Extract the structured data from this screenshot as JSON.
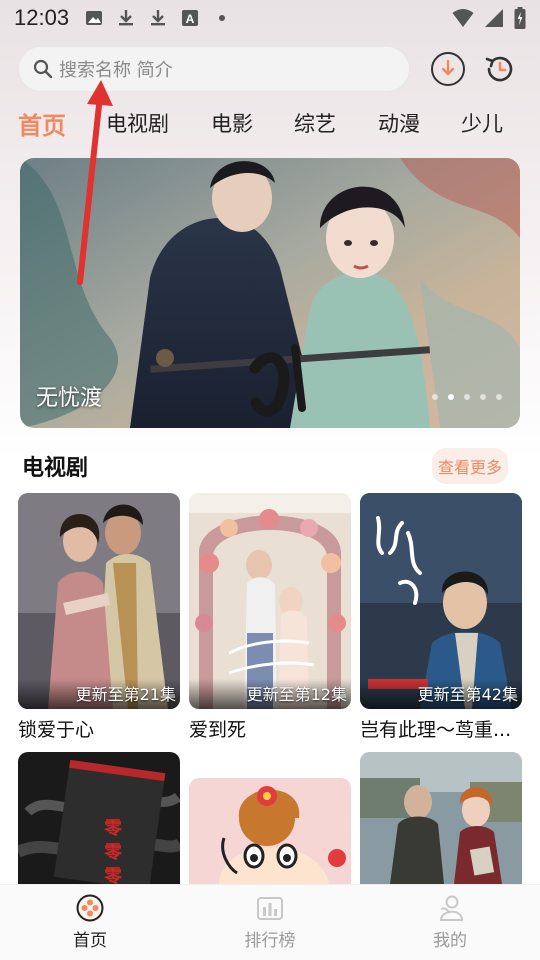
{
  "status_bar": {
    "time": "12:03",
    "left_icons": [
      "image-icon",
      "download-icon",
      "download-icon",
      "a-icon",
      "dot-icon"
    ],
    "right_icons": [
      "wifi-icon",
      "signal-icon",
      "battery-icon"
    ]
  },
  "search": {
    "placeholder": "搜索名称 简介"
  },
  "header_icons": [
    "download-circle-icon",
    "history-icon"
  ],
  "tabs": [
    {
      "label": "首页",
      "active": true
    },
    {
      "label": "电视剧",
      "active": false
    },
    {
      "label": "电影",
      "active": false
    },
    {
      "label": "综艺",
      "active": false
    },
    {
      "label": "动漫",
      "active": false
    },
    {
      "label": "少儿",
      "active": false
    }
  ],
  "banner": {
    "title": "无忧渡",
    "dots": 5,
    "active_dot": 1
  },
  "section": {
    "title": "电视剧",
    "more_label": "查看更多"
  },
  "cards": [
    {
      "name": "锁爱于心",
      "update": "更新至第21集"
    },
    {
      "name": "爱到死",
      "update": "更新至第12集"
    },
    {
      "name": "岂有此理～茑重...",
      "update": "更新至第42集"
    },
    {
      "name": "",
      "update": ""
    },
    {
      "name": "",
      "update": ""
    },
    {
      "name": "",
      "update": ""
    }
  ],
  "bottom_nav": [
    {
      "label": "首页",
      "icon": "home-film-icon",
      "active": true
    },
    {
      "label": "排行榜",
      "icon": "ranking-icon",
      "active": false
    },
    {
      "label": "我的",
      "icon": "profile-icon",
      "active": false
    }
  ],
  "colors": {
    "accent": "#f08860",
    "annotation_arrow": "#e0322e"
  }
}
